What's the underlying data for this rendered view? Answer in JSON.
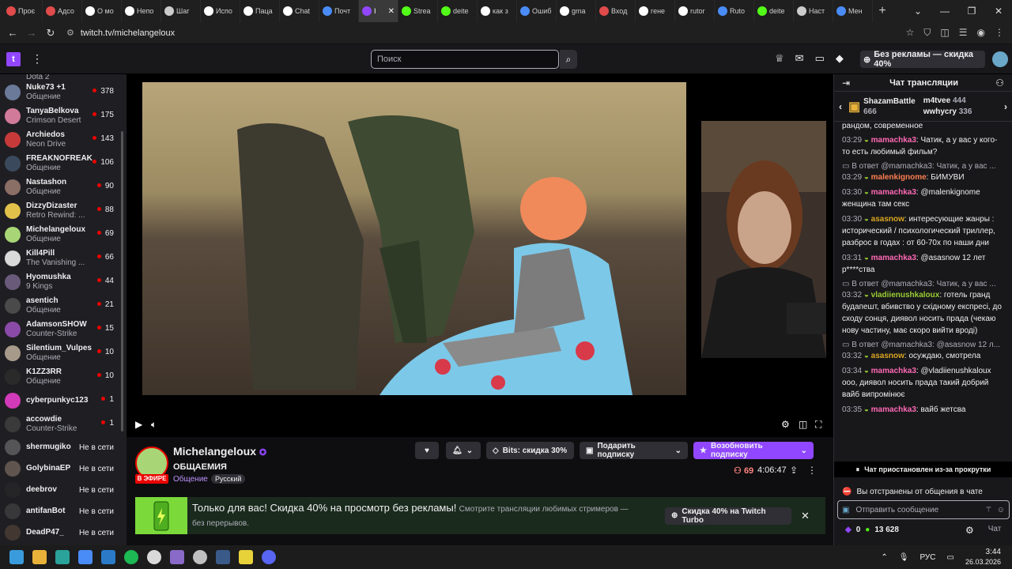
{
  "browser": {
    "tabs": [
      {
        "label": "Проє",
        "color": "#e04b4b"
      },
      {
        "label": "Адсо",
        "color": "#e04b4b"
      },
      {
        "label": "О мо",
        "color": "#ffffff"
      },
      {
        "label": "Непо",
        "color": "#ffffff"
      },
      {
        "label": "Шаг",
        "color": "#cccccc"
      },
      {
        "label": "Испо",
        "color": "#ffffff"
      },
      {
        "label": "Паца",
        "color": "#ffffff"
      },
      {
        "label": "Chat",
        "color": "#ffffff"
      },
      {
        "label": "Почт",
        "color": "#4a8cf7"
      },
      {
        "label": "I",
        "color": "#9147ff",
        "active": true
      },
      {
        "label": "Strea",
        "color": "#53fc18"
      },
      {
        "label": "deite",
        "color": "#53fc18"
      },
      {
        "label": "как з",
        "color": "#ffffff"
      },
      {
        "label": "Ошиб",
        "color": "#4a8cf7"
      },
      {
        "label": "gma",
        "color": "#ffffff"
      },
      {
        "label": "Вход",
        "color": "#e04b4b"
      },
      {
        "label": "гене",
        "color": "#ffffff"
      },
      {
        "label": "rutor",
        "color": "#ffffff"
      },
      {
        "label": "Ruto",
        "color": "#4a8cf7"
      },
      {
        "label": "deite",
        "color": "#53fc18"
      },
      {
        "label": "Наст",
        "color": "#cccccc"
      },
      {
        "label": "Мен",
        "color": "#4a8cf7"
      }
    ],
    "url": "twitch.tv/michelangeloux"
  },
  "topnav": {
    "search_placeholder": "Поиск",
    "adfree_label": "Без рекламы — скидка 40%"
  },
  "sidebar": {
    "top_partial": "Dota 2",
    "live": [
      {
        "name": "Nuke73 +1",
        "game": "Общение",
        "viewers": "378",
        "color": "#6b7a99"
      },
      {
        "name": "TanyaBelkova",
        "game": "Crimson Desert",
        "viewers": "175",
        "color": "#d17a9a"
      },
      {
        "name": "Archiedos",
        "game": "Neon Drive",
        "viewers": "143",
        "color": "#c73a3a"
      },
      {
        "name": "FREAKNOFREAK",
        "game": "Общение",
        "viewers": "106",
        "color": "#3a4a5c"
      },
      {
        "name": "Nastashon",
        "game": "Общение",
        "viewers": "90",
        "color": "#8a6f66"
      },
      {
        "name": "DizzyDizaster",
        "game": "Retro Rewind: ...",
        "viewers": "88",
        "color": "#e2c14b"
      },
      {
        "name": "Michelangeloux",
        "game": "Общение",
        "viewers": "69",
        "color": "#a8d676"
      },
      {
        "name": "Kill4Pill",
        "game": "The Vanishing ...",
        "viewers": "66",
        "color": "#d9d9d9"
      },
      {
        "name": "Hyomushka",
        "game": "9 Kings",
        "viewers": "44",
        "color": "#6a5a7a"
      },
      {
        "name": "asentich",
        "game": "Общение",
        "viewers": "21",
        "color": "#4a4a4a"
      },
      {
        "name": "AdamsonSHOW",
        "game": "Counter-Strike",
        "viewers": "15",
        "color": "#8a4aa8"
      },
      {
        "name": "Silentium_Vulpes",
        "game": "Общение",
        "viewers": "10",
        "color": "#a89a8a"
      },
      {
        "name": "K1ZZ3RR",
        "game": "Общение",
        "viewers": "10",
        "color": "#2a2a2a"
      },
      {
        "name": "cyberpunkyc123",
        "game": "",
        "viewers": "1",
        "color": "#d13ab8"
      },
      {
        "name": "accowdie",
        "game": "Counter-Strike",
        "viewers": "1",
        "color": "#3a3a3a"
      }
    ],
    "offline": [
      {
        "name": "shermugiko",
        "status": "Не в сети",
        "color": "#7a7a7a"
      },
      {
        "name": "GolybinaEP",
        "status": "Не в сети",
        "color": "#8a7a6a"
      },
      {
        "name": "deebrov",
        "status": "Не в сети",
        "color": "#2a2a2a"
      },
      {
        "name": "antifanBot",
        "status": "Не в сети",
        "color": "#4a4a4a"
      },
      {
        "name": "DeadP47_",
        "status": "Не в сети",
        "color": "#5a4a3a"
      }
    ]
  },
  "channel": {
    "name": "Michelangeloux",
    "live_badge": "В ЭФИРЕ",
    "title": "ОБЩАЕМИЯ",
    "category": "Общение",
    "tag": "Русский",
    "viewers": "69",
    "uptime": "4:06:47",
    "bits_label": "Bits: скидка 30%",
    "gift_label": "Подарить подписку",
    "renew_label": "Возобновить подписку"
  },
  "promo": {
    "headline": "Только для вас! Скидка 40% на просмотр без рекламы!",
    "sub": "Смотрите трансляции любимых стримеров — без перерывов.",
    "button": "Скидка 40% на Twitch Turbo"
  },
  "chat": {
    "header": "Чат трансляции",
    "leaderboard": [
      {
        "name": "ShazamBattle",
        "score": "666"
      },
      {
        "name": "m4tvee",
        "score": "444"
      },
      {
        "name": "wwhycry",
        "score": "336"
      }
    ],
    "top_partial": "рандом, современное",
    "messages": [
      {
        "time": "03:29",
        "user": "mamachka3",
        "ucls": "u1",
        "text": "Чатик, а у вас у кого-то есть любимый фильм?"
      },
      {
        "reply": "В ответ @mamachka3: Чатик, а у вас ...",
        "time": "03:29",
        "user": "malenkignome",
        "ucls": "u2",
        "text": "БИМУВИ"
      },
      {
        "time": "03:30",
        "user": "mamachka3",
        "ucls": "u1",
        "text": "@malenkignome женщина там секс"
      },
      {
        "time": "03:30",
        "user": "asasnow",
        "ucls": "u3",
        "text": "интересующие жанры : исторический / психологический триллер, разброс в годах : от 60-70х по наши дни"
      },
      {
        "time": "03:31",
        "user": "mamachka3",
        "ucls": "u1",
        "text": "@asasnow 12 лет р****ства"
      },
      {
        "reply": "В ответ @mamachka3: Чатик, а у вас ...",
        "time": "03:32",
        "user": "vladiienushkaloux",
        "ucls": "u4",
        "text": "готель гранд будапешт, вбивство у східному експресі, до сходу сонця, диявол носить прада (чекаю нову частину, має скоро вийти вроді)"
      },
      {
        "reply": "В ответ @mamachka3: @asasnow 12 л...",
        "time": "03:32",
        "user": "asasnow",
        "ucls": "u3",
        "text": "осуждаю, смотрела"
      },
      {
        "time": "03:34",
        "user": "mamachka3",
        "ucls": "u1",
        "text": "@vladiienushkaloux ooo, диявол носить прада такий добрий вайб випромінює"
      },
      {
        "time": "03:35",
        "user": "mamachka3",
        "ucls": "u1",
        "text": "вайб жетсва"
      }
    ],
    "paused": "Чат приостановлен из-за прокрутки",
    "banned": "Вы отстранены от общения в чате",
    "input_placeholder": "Отправить сообщение",
    "bits": "0",
    "points": "13 628",
    "send": "Чат"
  },
  "taskbar": {
    "lang": "РУС",
    "time": "3:44",
    "date": "26.03.2026"
  }
}
